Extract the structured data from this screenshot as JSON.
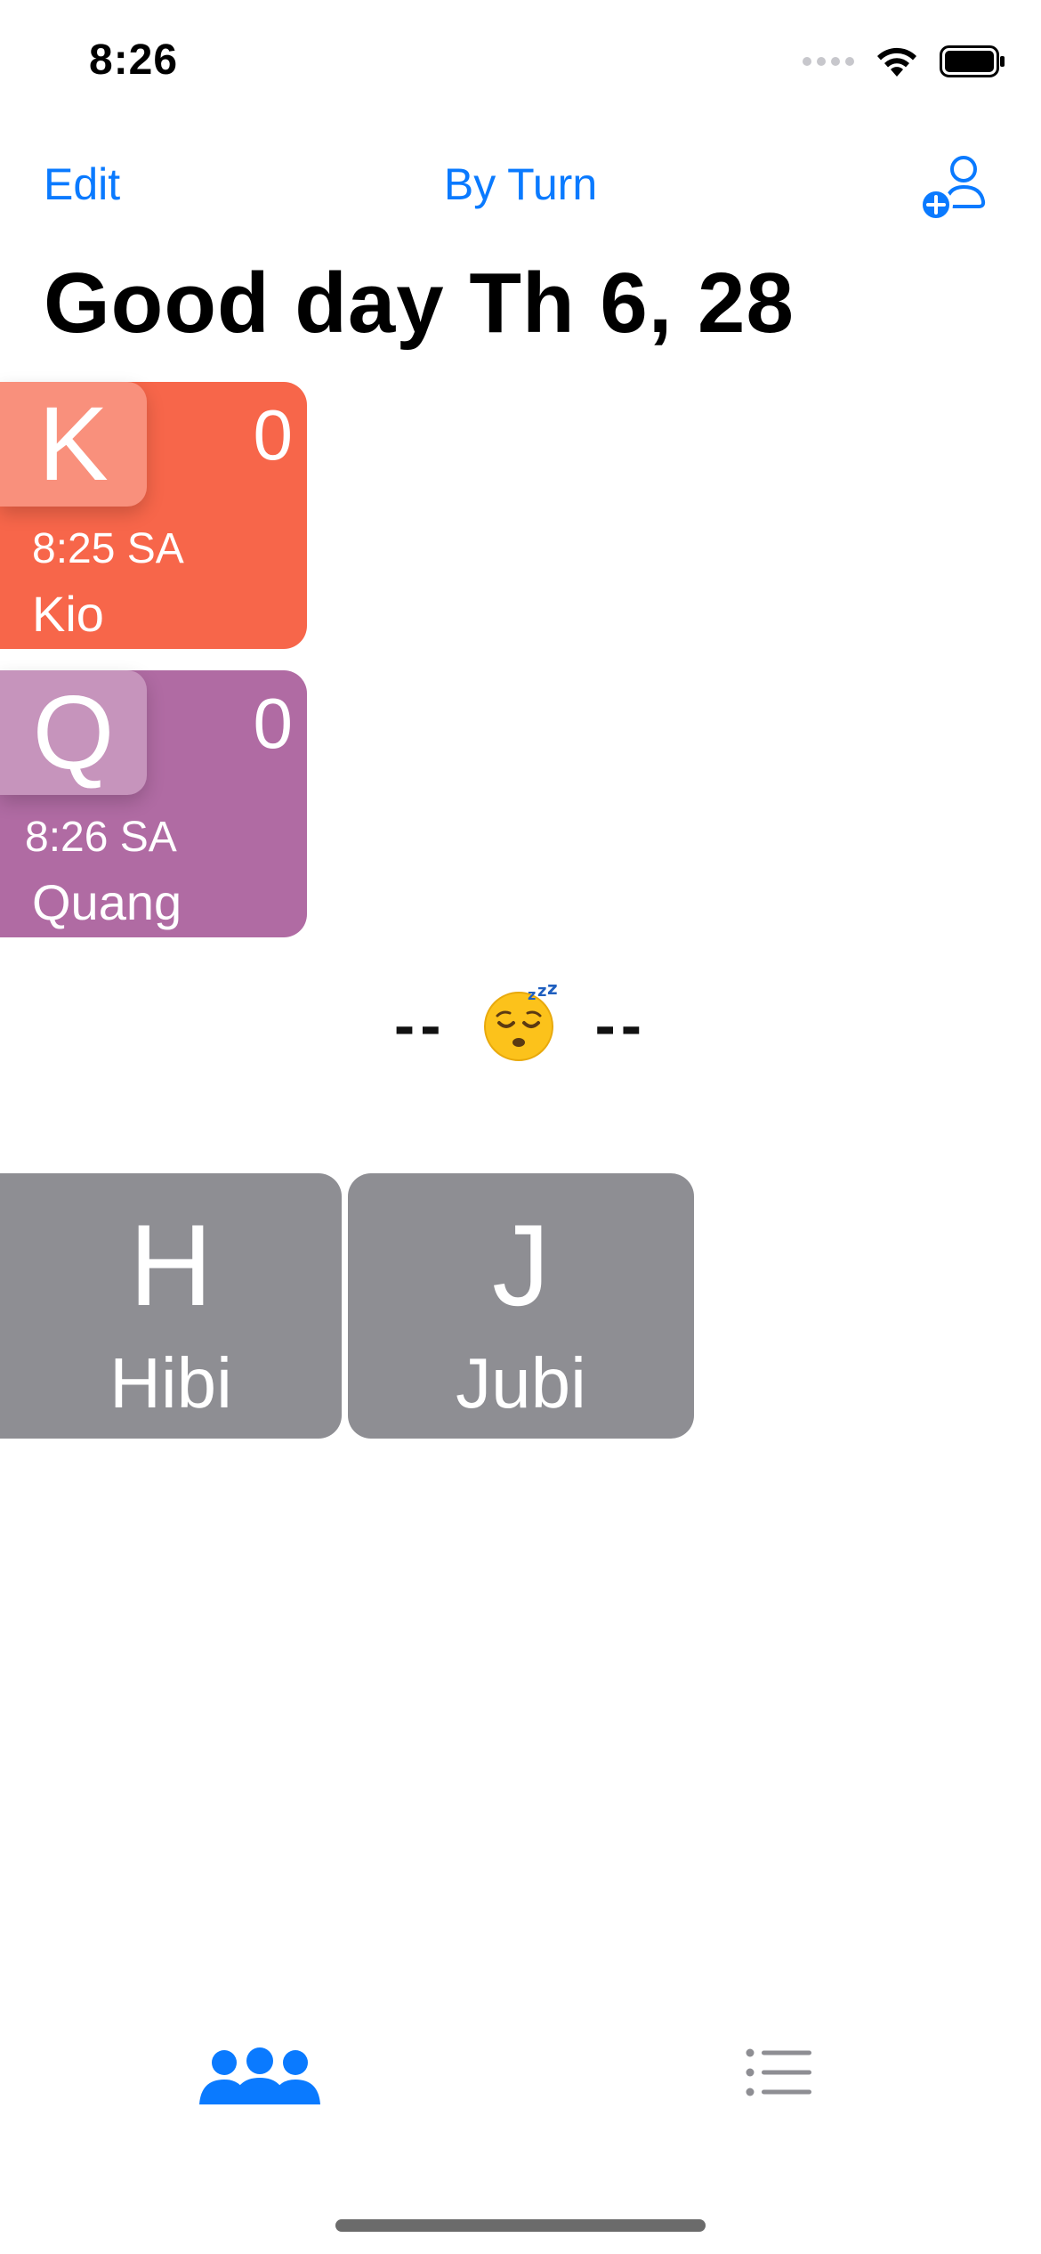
{
  "status_bar": {
    "time": "8:26"
  },
  "nav": {
    "edit_label": "Edit",
    "title": "By Turn",
    "add_icon": "person-add-icon"
  },
  "page": {
    "title": "Good day Th 6, 28"
  },
  "active_players": [
    {
      "initial": "K",
      "score": "0",
      "time": "8:25 SA",
      "name": "Kio",
      "color": "#f7664a"
    },
    {
      "initial": "Q",
      "score": "0",
      "time": "8:26 SA",
      "name": "Quang",
      "color": "#b06ba3"
    }
  ],
  "divider": {
    "left": "--",
    "right": "--",
    "emoji": "sleeping-face"
  },
  "inactive_players": [
    {
      "initial": "H",
      "name": "Hibi",
      "color": "#8e8e93"
    },
    {
      "initial": "J",
      "name": "Jubi",
      "color": "#8e8e93"
    }
  ],
  "tab_bar": {
    "tabs": [
      {
        "icon": "people-icon",
        "selected": true,
        "color": "#0a7aff"
      },
      {
        "icon": "list-icon",
        "selected": false,
        "color": "#8e8e93"
      }
    ]
  },
  "accent_color": "#0a7aff"
}
